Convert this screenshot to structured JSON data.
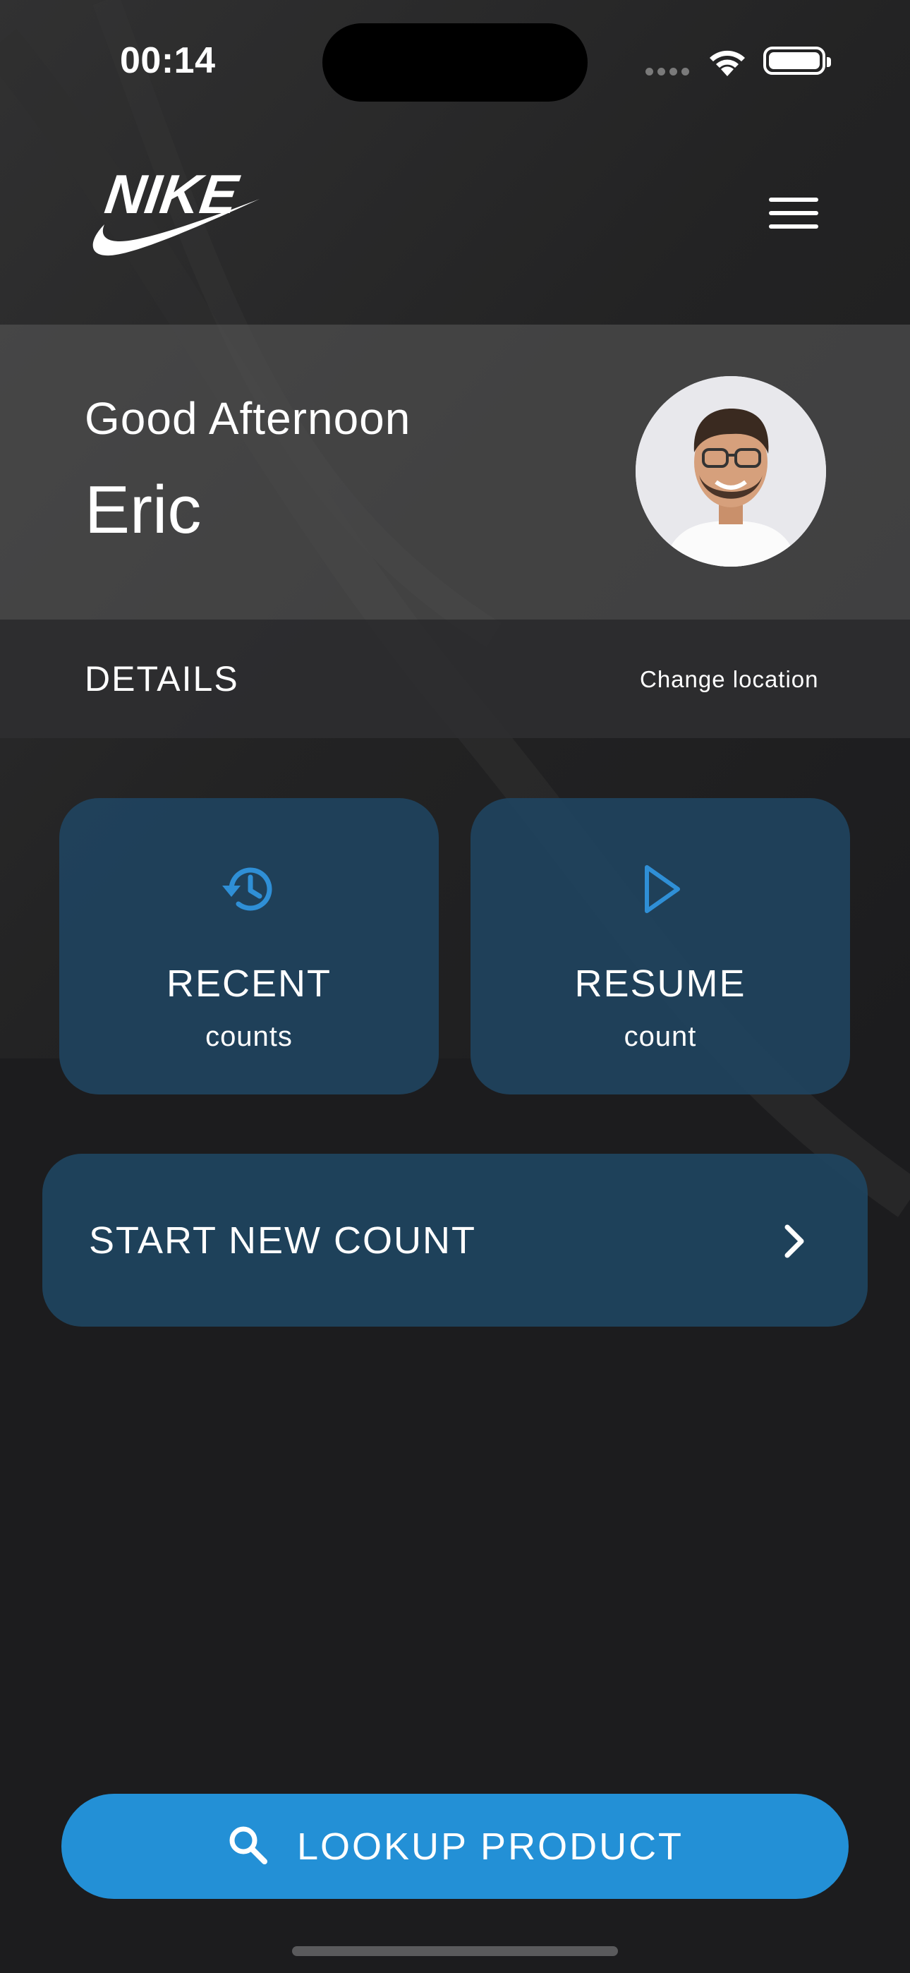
{
  "status_bar": {
    "time": "00:14"
  },
  "header": {
    "brand": "NIKE",
    "menu_icon": "hamburger-menu-icon"
  },
  "greeting": {
    "salutation": "Good Afternoon",
    "name": "Eric"
  },
  "details": {
    "label": "DETAILS",
    "change_location": "Change location"
  },
  "cards": {
    "recent": {
      "title": "RECENT",
      "subtitle": "counts",
      "icon": "history-icon"
    },
    "resume": {
      "title": "RESUME",
      "subtitle": "count",
      "icon": "play-icon"
    }
  },
  "start": {
    "label": "START NEW COUNT",
    "icon": "chevron-right-icon"
  },
  "lookup": {
    "label": "LOOKUP PRODUCT",
    "icon": "search-icon"
  },
  "colors": {
    "accent": "#2390d6",
    "card": "#1f435e",
    "background": "#1c1c1e"
  }
}
